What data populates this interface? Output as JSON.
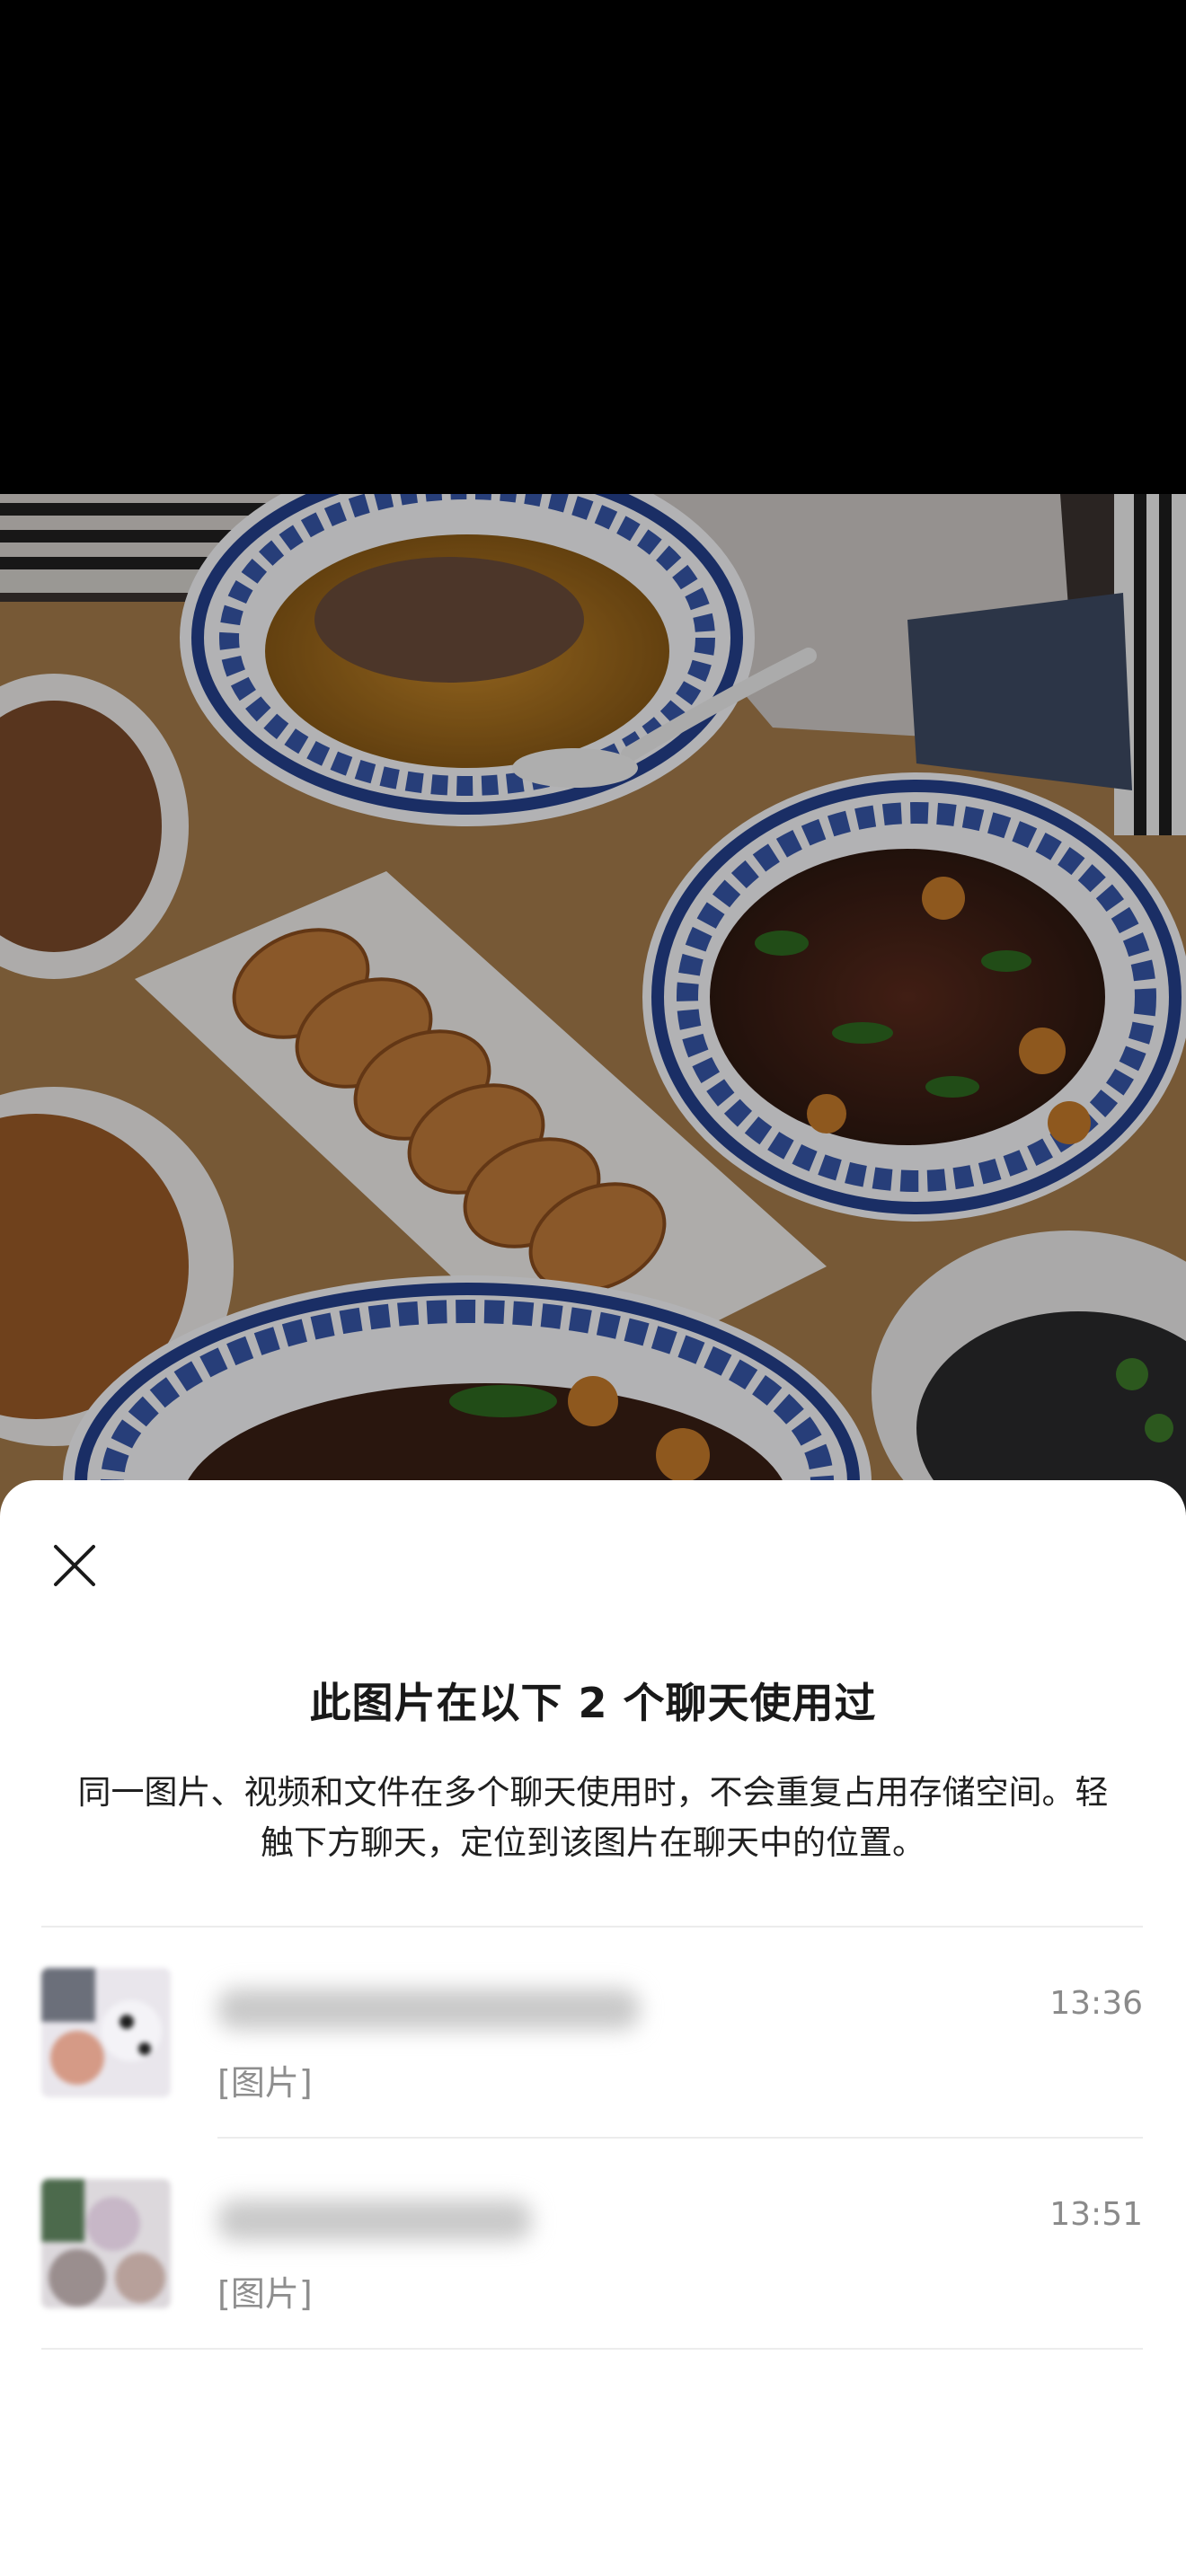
{
  "sheet": {
    "title": "此图片在以下 2 个聊天使用过",
    "description": "同一图片、视频和文件在多个聊天使用时，不会重复占用存储空间。轻触下方聊天，定位到该图片在聊天中的位置。"
  },
  "chats": [
    {
      "name": "",
      "time": "13:36",
      "preview": "[图片]"
    },
    {
      "name": "",
      "time": "13:51",
      "preview": "[图片]"
    }
  ],
  "icons": {
    "close": "close-icon"
  }
}
